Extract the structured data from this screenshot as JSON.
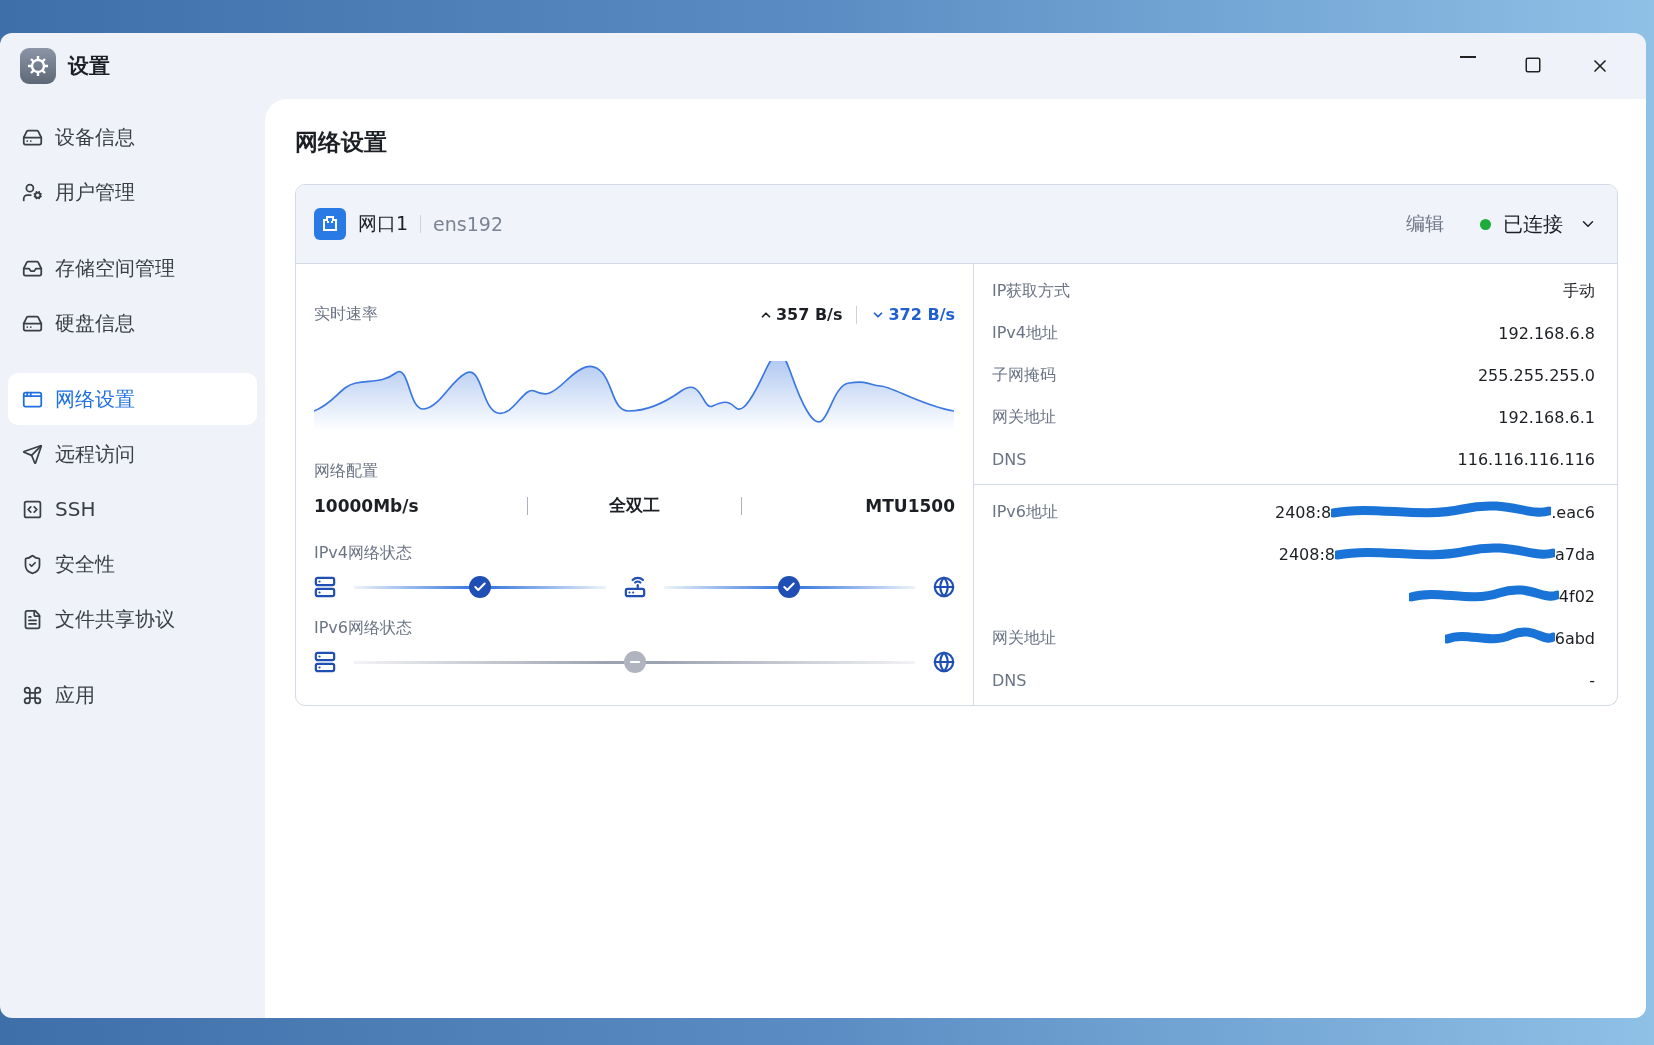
{
  "window": {
    "title": "设置"
  },
  "sidebar": {
    "groups": [
      [
        {
          "label": "设备信息",
          "selected": false
        },
        {
          "label": "用户管理",
          "selected": false
        }
      ],
      [
        {
          "label": "存储空间管理",
          "selected": false
        },
        {
          "label": "硬盘信息",
          "selected": false
        }
      ],
      [
        {
          "label": "网络设置",
          "selected": true
        },
        {
          "label": "远程访问",
          "selected": false
        },
        {
          "label": "SSH",
          "selected": false
        },
        {
          "label": "安全性",
          "selected": false
        },
        {
          "label": "文件共享协议",
          "selected": false
        }
      ],
      [
        {
          "label": "应用",
          "selected": false
        }
      ]
    ]
  },
  "page": {
    "title": "网络设置"
  },
  "card": {
    "name": "网口1",
    "interface": "ens192",
    "edit": "编辑",
    "status": "已连接",
    "connected": true,
    "expanded": true,
    "speed": {
      "label": "实时速率",
      "upload": "357 B/s",
      "download": "372 B/s"
    },
    "config": {
      "label": "网络配置",
      "values": [
        "10000Mb/s",
        "全双工",
        "MTU1500"
      ]
    },
    "ipv4_status": {
      "label": "IPv4网络状态",
      "links": [
        {
          "connected": true
        },
        {
          "connected": true
        }
      ]
    },
    "ipv6_status": {
      "label": "IPv6网络状态",
      "links": [
        {
          "connected": false
        }
      ]
    },
    "ipv4": [
      {
        "label": "IP获取方式",
        "value": "手动"
      },
      {
        "label": "IPv4地址",
        "value": "192.168.6.8"
      },
      {
        "label": "子网掩码",
        "value": "255.255.255.0"
      },
      {
        "label": "网关地址",
        "value": "192.168.6.1"
      },
      {
        "label": "DNS",
        "value": "116.116.116.116"
      }
    ],
    "ipv6": [
      {
        "label": "IPv6地址",
        "start": "2408:8",
        "end": ".eac6"
      },
      {
        "start": "2408:8",
        "end": "a7da"
      },
      {
        "end": "4f02"
      },
      {
        "label": "网关地址",
        "end": "6abd"
      },
      {
        "label": "DNS",
        "end": "-"
      }
    ]
  }
}
